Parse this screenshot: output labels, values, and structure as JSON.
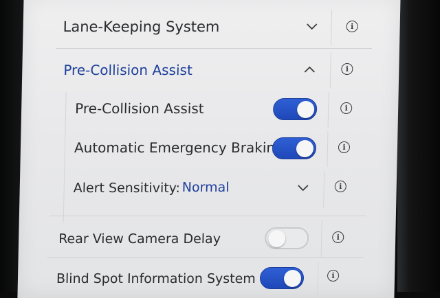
{
  "settings": {
    "lane_keeping": {
      "label": "Lane-Keeping System",
      "expanded": false
    },
    "pre_collision": {
      "label": "Pre-Collision Assist",
      "expanded": true,
      "items": [
        {
          "label": "Pre-Collision Assist",
          "enabled": true
        },
        {
          "label": "Automatic Emergency Braking",
          "enabled": true
        }
      ],
      "alert_sensitivity": {
        "label": "Alert Sensitivity:",
        "value": "Normal"
      }
    },
    "rear_camera_delay": {
      "label": "Rear View Camera Delay",
      "enabled": false
    },
    "blind_spot": {
      "label": "Blind Spot Information System",
      "enabled": true
    }
  },
  "colors": {
    "accent": "#1e3f9c",
    "toggle_on": "#2553c8",
    "text": "#2a2b2d"
  },
  "icons": {
    "info": "info-circle-icon",
    "expand": "chevron-down-icon",
    "collapse": "chevron-up-icon"
  }
}
